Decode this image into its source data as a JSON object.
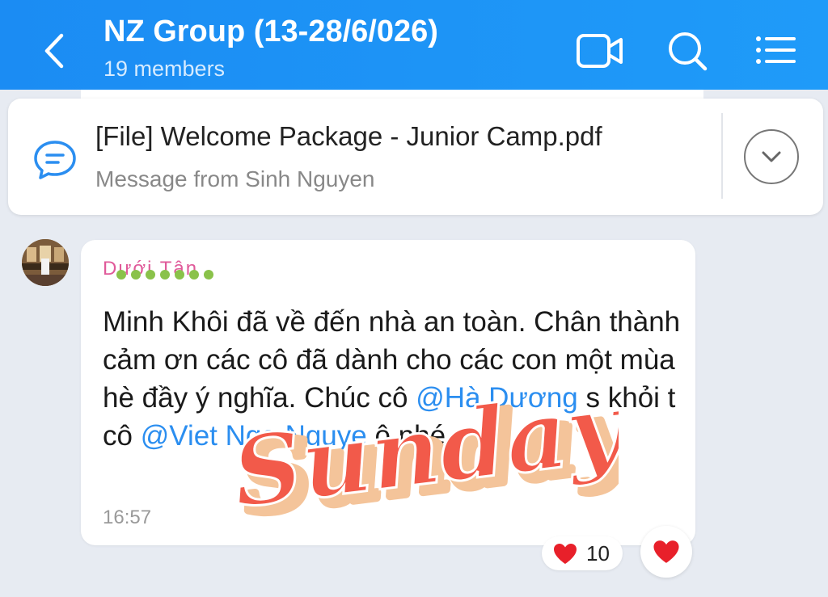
{
  "header": {
    "title": "NZ Group (13-28/6/026)",
    "subtitle": "19 members",
    "icons": [
      "back-icon",
      "video-call-icon",
      "search-icon",
      "menu-list-icon"
    ]
  },
  "pinned": {
    "title": "[File] Welcome Package - Junior Camp.pdf",
    "subtitle": "Message from Sinh Nguyen",
    "icon": "chat-bubble-icon",
    "expand_icon": "chevron-down-icon"
  },
  "message": {
    "sender": "Dưới Tân",
    "text_part1": "Minh Khôi đã về đến nhà an toàn. Chân thành cảm ơn các cô đã dành cho các con một mùa hè đầy ý nghĩa. Chúc cô ",
    "mention1": "@Hà Dương",
    "text_part2": " s      khỏi t      cô ",
    "mention2": "@Viet Nga Nguye",
    "text_part3": "                   ô nhé",
    "time": "16:57",
    "sticker_text": "Sunday"
  },
  "reactions": {
    "emoji": "heart",
    "count": "10"
  },
  "colors": {
    "header": "#1f9bf9",
    "accent": "#2b8ef0",
    "sender": "#e05a9a",
    "sticker": "#f25a4a",
    "heart": "#e8202a"
  }
}
